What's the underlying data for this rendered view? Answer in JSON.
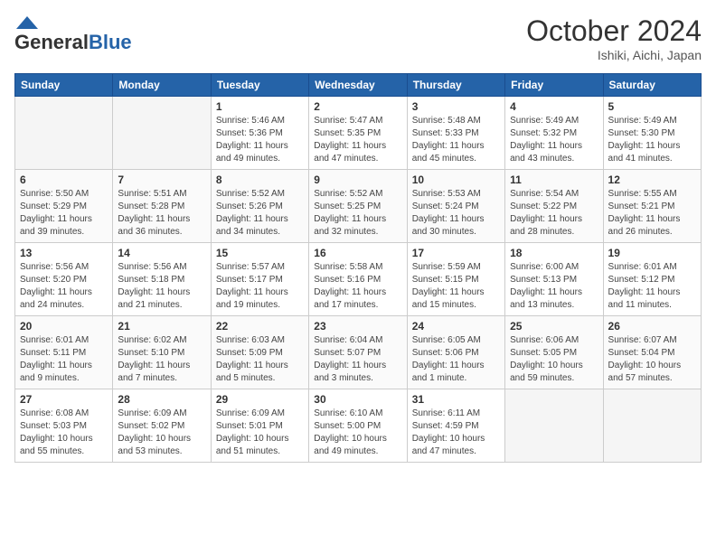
{
  "logo": {
    "general": "General",
    "blue": "Blue"
  },
  "title": "October 2024",
  "location": "Ishiki, Aichi, Japan",
  "days_of_week": [
    "Sunday",
    "Monday",
    "Tuesday",
    "Wednesday",
    "Thursday",
    "Friday",
    "Saturday"
  ],
  "weeks": [
    [
      {
        "day": "",
        "info": ""
      },
      {
        "day": "",
        "info": ""
      },
      {
        "day": "1",
        "info": "Sunrise: 5:46 AM\nSunset: 5:36 PM\nDaylight: 11 hours and 49 minutes."
      },
      {
        "day": "2",
        "info": "Sunrise: 5:47 AM\nSunset: 5:35 PM\nDaylight: 11 hours and 47 minutes."
      },
      {
        "day": "3",
        "info": "Sunrise: 5:48 AM\nSunset: 5:33 PM\nDaylight: 11 hours and 45 minutes."
      },
      {
        "day": "4",
        "info": "Sunrise: 5:49 AM\nSunset: 5:32 PM\nDaylight: 11 hours and 43 minutes."
      },
      {
        "day": "5",
        "info": "Sunrise: 5:49 AM\nSunset: 5:30 PM\nDaylight: 11 hours and 41 minutes."
      }
    ],
    [
      {
        "day": "6",
        "info": "Sunrise: 5:50 AM\nSunset: 5:29 PM\nDaylight: 11 hours and 39 minutes."
      },
      {
        "day": "7",
        "info": "Sunrise: 5:51 AM\nSunset: 5:28 PM\nDaylight: 11 hours and 36 minutes."
      },
      {
        "day": "8",
        "info": "Sunrise: 5:52 AM\nSunset: 5:26 PM\nDaylight: 11 hours and 34 minutes."
      },
      {
        "day": "9",
        "info": "Sunrise: 5:52 AM\nSunset: 5:25 PM\nDaylight: 11 hours and 32 minutes."
      },
      {
        "day": "10",
        "info": "Sunrise: 5:53 AM\nSunset: 5:24 PM\nDaylight: 11 hours and 30 minutes."
      },
      {
        "day": "11",
        "info": "Sunrise: 5:54 AM\nSunset: 5:22 PM\nDaylight: 11 hours and 28 minutes."
      },
      {
        "day": "12",
        "info": "Sunrise: 5:55 AM\nSunset: 5:21 PM\nDaylight: 11 hours and 26 minutes."
      }
    ],
    [
      {
        "day": "13",
        "info": "Sunrise: 5:56 AM\nSunset: 5:20 PM\nDaylight: 11 hours and 24 minutes."
      },
      {
        "day": "14",
        "info": "Sunrise: 5:56 AM\nSunset: 5:18 PM\nDaylight: 11 hours and 21 minutes."
      },
      {
        "day": "15",
        "info": "Sunrise: 5:57 AM\nSunset: 5:17 PM\nDaylight: 11 hours and 19 minutes."
      },
      {
        "day": "16",
        "info": "Sunrise: 5:58 AM\nSunset: 5:16 PM\nDaylight: 11 hours and 17 minutes."
      },
      {
        "day": "17",
        "info": "Sunrise: 5:59 AM\nSunset: 5:15 PM\nDaylight: 11 hours and 15 minutes."
      },
      {
        "day": "18",
        "info": "Sunrise: 6:00 AM\nSunset: 5:13 PM\nDaylight: 11 hours and 13 minutes."
      },
      {
        "day": "19",
        "info": "Sunrise: 6:01 AM\nSunset: 5:12 PM\nDaylight: 11 hours and 11 minutes."
      }
    ],
    [
      {
        "day": "20",
        "info": "Sunrise: 6:01 AM\nSunset: 5:11 PM\nDaylight: 11 hours and 9 minutes."
      },
      {
        "day": "21",
        "info": "Sunrise: 6:02 AM\nSunset: 5:10 PM\nDaylight: 11 hours and 7 minutes."
      },
      {
        "day": "22",
        "info": "Sunrise: 6:03 AM\nSunset: 5:09 PM\nDaylight: 11 hours and 5 minutes."
      },
      {
        "day": "23",
        "info": "Sunrise: 6:04 AM\nSunset: 5:07 PM\nDaylight: 11 hours and 3 minutes."
      },
      {
        "day": "24",
        "info": "Sunrise: 6:05 AM\nSunset: 5:06 PM\nDaylight: 11 hours and 1 minute."
      },
      {
        "day": "25",
        "info": "Sunrise: 6:06 AM\nSunset: 5:05 PM\nDaylight: 10 hours and 59 minutes."
      },
      {
        "day": "26",
        "info": "Sunrise: 6:07 AM\nSunset: 5:04 PM\nDaylight: 10 hours and 57 minutes."
      }
    ],
    [
      {
        "day": "27",
        "info": "Sunrise: 6:08 AM\nSunset: 5:03 PM\nDaylight: 10 hours and 55 minutes."
      },
      {
        "day": "28",
        "info": "Sunrise: 6:09 AM\nSunset: 5:02 PM\nDaylight: 10 hours and 53 minutes."
      },
      {
        "day": "29",
        "info": "Sunrise: 6:09 AM\nSunset: 5:01 PM\nDaylight: 10 hours and 51 minutes."
      },
      {
        "day": "30",
        "info": "Sunrise: 6:10 AM\nSunset: 5:00 PM\nDaylight: 10 hours and 49 minutes."
      },
      {
        "day": "31",
        "info": "Sunrise: 6:11 AM\nSunset: 4:59 PM\nDaylight: 10 hours and 47 minutes."
      },
      {
        "day": "",
        "info": ""
      },
      {
        "day": "",
        "info": ""
      }
    ]
  ]
}
